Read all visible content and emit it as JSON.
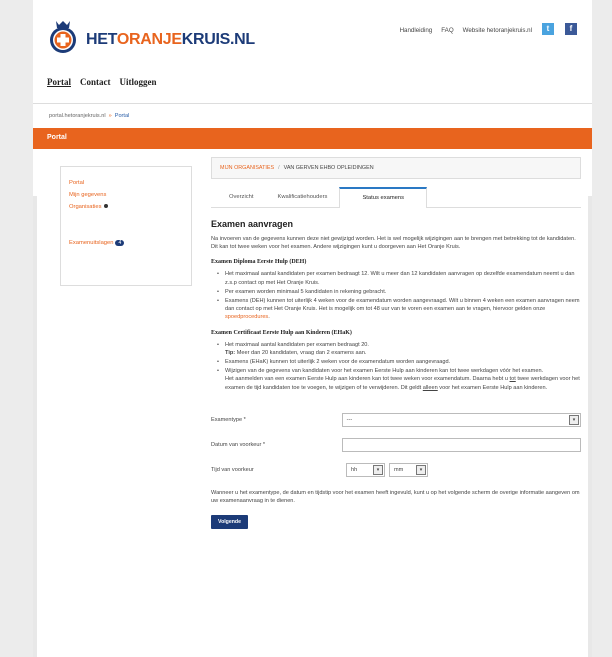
{
  "brand": {
    "prefix": "HET",
    "middle": "ORANJE",
    "suffix": "KRUIS.NL"
  },
  "toplinks": [
    "Handleiding",
    "FAQ",
    "Website hetoranjekruis.nl"
  ],
  "social": {
    "twitter": "t",
    "facebook": "f",
    "twitter_icon": "twitter-icon",
    "facebook_icon": "facebook-icon"
  },
  "mainnav": [
    "Portal",
    "Contact",
    "Uitloggen"
  ],
  "breadcrumb": {
    "root": "portal.hetoranjekruis.nl",
    "current": "Portal"
  },
  "section_title": "Portal",
  "sidebar": {
    "items": [
      "Portal",
      "Mijn gegevens",
      "Organisaties"
    ],
    "extra": "Examenuitslagen",
    "badge": "4"
  },
  "org": {
    "org_label": "MIJN ORGANISATIES",
    "company": "VAN GERVEN EHBO OPLEIDINGEN"
  },
  "tabs": [
    "Overzicht",
    "Kwalificatiehouders",
    "Status examens"
  ],
  "heading": "Examen aanvragen",
  "intro": "Na invoeren van de gegevens kunnen deze niet gewijzigd worden. Het is wel mogelijk wijzigingen aan te brengen met betrekking tot de kandidaten. Dit kan tot twee weken voor het examen. Andere wijzigingen kunt u doorgeven aan Het Oranje Kruis.",
  "deh": {
    "title": "Examen Diploma Eerste Hulp (DEH)",
    "b1": "Het maximaal aantal kandidaten per examen bedraagt 12. Wilt u meer dan 12 kandidaten aanvragen op dezelfde examendatum neemt u dan z.s.p contact op met Het Oranje Kruis.",
    "b2": "Per examen worden minimaal 5 kandidaten in rekening gebracht.",
    "b3": "Examens (DEH) kunnen tot uiterlijk 4 weken voor de examendatum worden aangevraagd. Wilt u binnen 4 weken een examen aanvragen neem dan contact op met Het Oranje Kruis. Het is mogelijk om tot 48 uur van te voren een examen aan te vragen, hiervoor gelden onze",
    "b3_link": "spoedprocedures",
    "b3_end": "."
  },
  "ehak": {
    "title": "Examen Certificaat Eerste Hulp aan Kinderen (EHaK)",
    "b1": "Het maximaal aantal kandidaten per examen bedraagt 20.",
    "b1_tip": "Tip:",
    "b1_tip_text": "Meer dan 20 kandidaten, vraag dan 2 examens aan.",
    "b2": "Examens (EHaK) kunnen tot uiterlijk 2 weken voor de examendatum worden aangevraagd.",
    "b3": "Wijzigen van de gegevens van kandidaten voor het examen Eerste Hulp aan kinderen kan tot twee werkdagen vóór het examen.",
    "b3_p2a": "Het aanmelden van een examen Eerste Hulp aan kinderen kan tot twee weken voor examendatum. Daarna hebt u",
    "b3_tot": "tot",
    "b3_p2b": "twee werkdagen voor het examen de tijd kandidaten toe te voegen, te wijzigen of te verwijderen. Dit geldt",
    "b3_alleen": "alleen",
    "b3_p2c": "voor het examen Eerste Hulp aan kinderen."
  },
  "form": {
    "examtype_label": "Examentype *",
    "examtype_value": "---",
    "date_label": "Datum van voorkeur *",
    "date_value": "",
    "time_label": "Tijd van voorkeur",
    "hh": "hh",
    "mm": "mm",
    "arrow": "▾"
  },
  "note": "Wanneer u het examentype, de datum en tijdstip voor het examen heeft ingevuld, kunt u op het volgende scherm de overige informatie aangeven om uw examenaanvraag in te dienen.",
  "next_button": "Volgende"
}
